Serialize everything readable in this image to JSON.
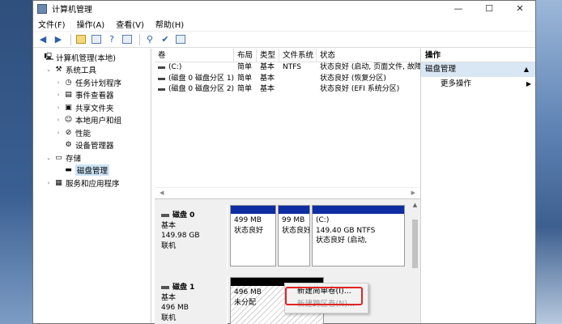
{
  "window": {
    "title": "计算机管理",
    "controls": [
      "—",
      "☐",
      "✕"
    ]
  },
  "menu": [
    "文件(F)",
    "操作(A)",
    "查看(V)",
    "帮助(H)"
  ],
  "tree": [
    {
      "label": "计算机管理(本地)",
      "exp": "",
      "icon": "computer-icon"
    },
    {
      "label": "系统工具",
      "exp": "⌄",
      "icon": "tools-icon"
    },
    {
      "label": "任务计划程序",
      "exp": "›",
      "icon": "clock-icon"
    },
    {
      "label": "事件查看器",
      "exp": "›",
      "icon": "event-viewer-icon"
    },
    {
      "label": "共享文件夹",
      "exp": "›",
      "icon": "shared-folder-icon"
    },
    {
      "label": "本地用户和组",
      "exp": "›",
      "icon": "users-icon"
    },
    {
      "label": "性能",
      "exp": "›",
      "icon": "performance-icon"
    },
    {
      "label": "设备管理器",
      "exp": "",
      "icon": "device-manager-icon"
    },
    {
      "label": "存储",
      "exp": "⌄",
      "icon": "storage-icon"
    },
    {
      "label": "磁盘管理",
      "exp": "",
      "icon": "disk-icon"
    },
    {
      "label": "服务和应用程序",
      "exp": "›",
      "icon": "services-icon"
    }
  ],
  "volume_headers": [
    "卷",
    "布局",
    "类型",
    "文件系统",
    "状态"
  ],
  "volumes": [
    [
      "(C:)",
      "简单",
      "基本",
      "NTFS",
      "状态良好 (启动, 页面文件, 故障"
    ],
    [
      "(磁盘 0 磁盘分区 1)",
      "简单",
      "基本",
      "",
      "状态良好 (恢复分区)"
    ],
    [
      "(磁盘 0 磁盘分区 2)",
      "简单",
      "基本",
      "",
      "状态良好 (EFI 系统分区)"
    ]
  ],
  "disks": [
    {
      "name": "磁盘 0",
      "type": "基本",
      "size": "149.98 GB",
      "status": "联机",
      "partitions": [
        {
          "l1": "",
          "l2": "499 MB",
          "l3": "状态良好"
        },
        {
          "l1": "",
          "l2": "99 MB",
          "l3": "状态良好"
        },
        {
          "l1": "(C:)",
          "l2": "149.40 GB NTFS",
          "l3": "状态良好 (启动,"
        }
      ]
    },
    {
      "name": "磁盘 1",
      "type": "基本",
      "size": "496 MB",
      "status": "联机",
      "partitions": [
        {
          "l1": "",
          "l2": "496 MB",
          "l3": "未分配"
        }
      ]
    }
  ],
  "context_menu": [
    {
      "label": "新建简单卷(I)...",
      "disabled": false
    },
    {
      "label": "新建跨区卷(N)...",
      "disabled": true
    }
  ],
  "actions": {
    "header": "操作",
    "section": "磁盘管理",
    "items": [
      "更多操作"
    ]
  },
  "colors": {
    "partition_bar": "#0e2da3",
    "unallocated_bar": "#000000",
    "selection": "#cce4f7",
    "highlight_box": "#e02424"
  }
}
